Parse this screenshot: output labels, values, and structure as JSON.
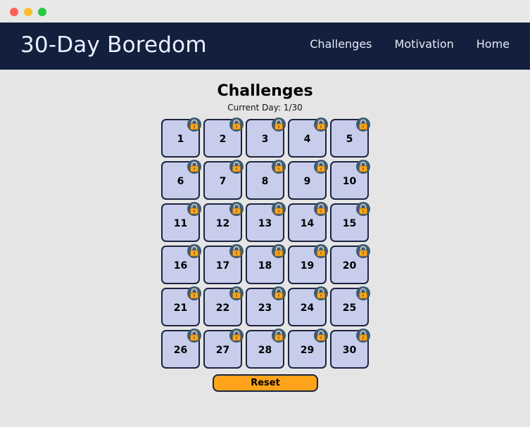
{
  "app": {
    "brand": "30-Day Boredom"
  },
  "nav": [
    {
      "label": "Challenges"
    },
    {
      "label": "Motivation"
    },
    {
      "label": "Home"
    }
  ],
  "page": {
    "title": "Challenges",
    "current_day": "Current Day: 1/30"
  },
  "days": [
    "1",
    "2",
    "3",
    "4",
    "5",
    "6",
    "7",
    "8",
    "9",
    "10",
    "11",
    "12",
    "13",
    "14",
    "15",
    "16",
    "17",
    "18",
    "19",
    "20",
    "21",
    "22",
    "23",
    "24",
    "25",
    "26",
    "27",
    "28",
    "29",
    "30"
  ],
  "day_icon": "lock-icon",
  "reset_label": "Reset",
  "colors": {
    "header_bg": "#13203d",
    "page_bg": "#e5e5e5",
    "tile_bg": "#c8cdec",
    "tile_border": "#1b2540",
    "lock_bg": "#3d5b73",
    "lock_body": "#f5a623",
    "reset_bg": "#ffa41a"
  }
}
